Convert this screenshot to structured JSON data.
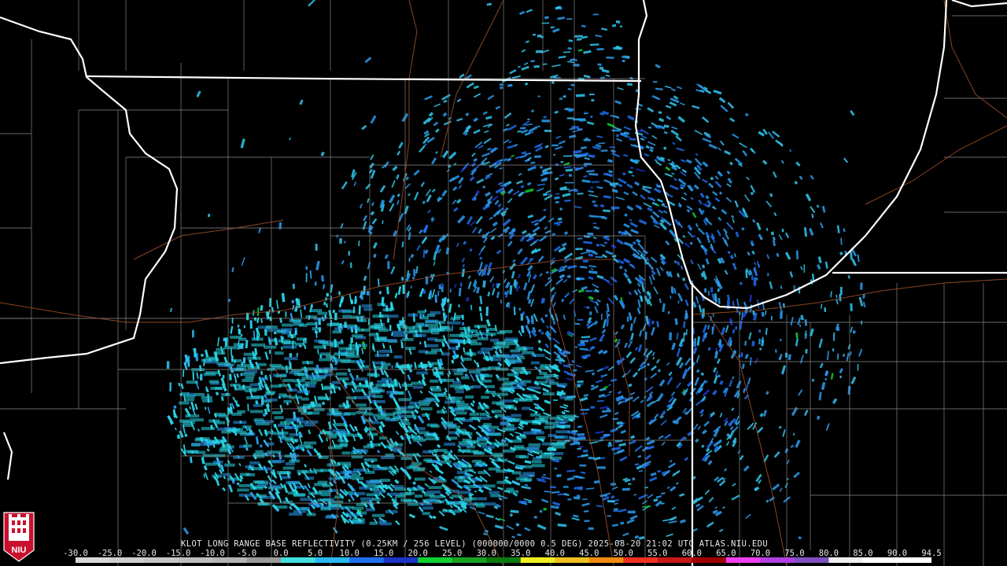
{
  "product": {
    "caption": "KLOT LONG RANGE BASE REFLECTIVITY (0.25KM / 256 LEVEL) (000000/0000 0.5 DEG) 2025-08-20 21:02 UTC  ATLAS.NIU.EDU",
    "logo_text": "NIU"
  },
  "scale": {
    "labels": [
      "-30.0",
      "-25.0",
      "-20.0",
      "-15.0",
      "-10.0",
      "-5.0",
      "0.0",
      "5.0",
      "10.0",
      "15.0",
      "20.0",
      "25.0",
      "30.0",
      "35.0",
      "40.0",
      "45.0",
      "50.0",
      "55.0",
      "60.0",
      "65.0",
      "70.0",
      "75.0",
      "80.0",
      "85.0",
      "90.0",
      "94.5"
    ],
    "colors": [
      "#d8d8d8",
      "#cfcfcf",
      "#c6c6c6",
      "#bdbdbd",
      "#b4b4b4",
      "#9a9a9a",
      "#40e0e0",
      "#2ab8f0",
      "#1e6ff0",
      "#1c32c8",
      "#10d030",
      "#18a020",
      "#0c7a10",
      "#f0f020",
      "#f0c020",
      "#f08c10",
      "#f03020",
      "#c81818",
      "#a00000",
      "#f040f0",
      "#b040e0",
      "#8050c0",
      "#f0f0f0",
      "#ffffff",
      "#ffffff"
    ],
    "label_color": "#e8e8e8"
  },
  "map": {
    "background": "#000000",
    "state_border_color": "#ffffff",
    "county_color": "#8a8a8a",
    "road_color": "#a0522d",
    "echo_colors": [
      "#28d8e8",
      "#30c8f0",
      "#2a9cf0",
      "#1e6ff0",
      "#1c32c8",
      "#10d030"
    ]
  }
}
